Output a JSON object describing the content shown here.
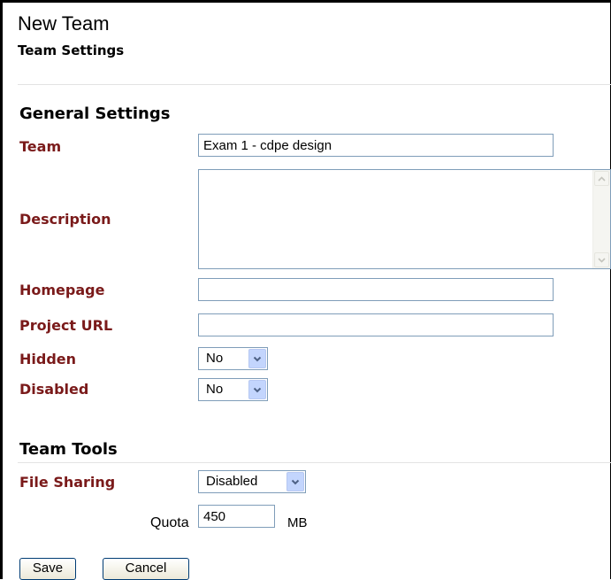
{
  "header": {
    "title": "New Team",
    "subtitle": "Team Settings"
  },
  "general": {
    "heading": "General Settings",
    "team_label": "Team",
    "team_value": "Exam 1 - cdpe design",
    "description_label": "Description",
    "description_value": "",
    "homepage_label": "Homepage",
    "homepage_value": "",
    "project_url_label": "Project URL",
    "project_url_value": "",
    "hidden_label": "Hidden",
    "hidden_value": "No",
    "disabled_label": "Disabled",
    "disabled_value": "No"
  },
  "tools": {
    "heading": "Team Tools",
    "file_sharing_label": "File Sharing",
    "file_sharing_value": "Disabled",
    "quota_label": "Quota",
    "quota_value": "450",
    "quota_unit": "MB"
  },
  "actions": {
    "save_label": "Save",
    "cancel_label": "Cancel"
  },
  "icons": {
    "dropdown": "chevron-down-icon",
    "scroll_up": "scroll-up-arrow-icon",
    "scroll_down": "scroll-down-arrow-icon"
  },
  "colors": {
    "label": "#7a1a1a",
    "dropdown_button": "#c3d5fd",
    "field_border": "#7f9db9"
  }
}
